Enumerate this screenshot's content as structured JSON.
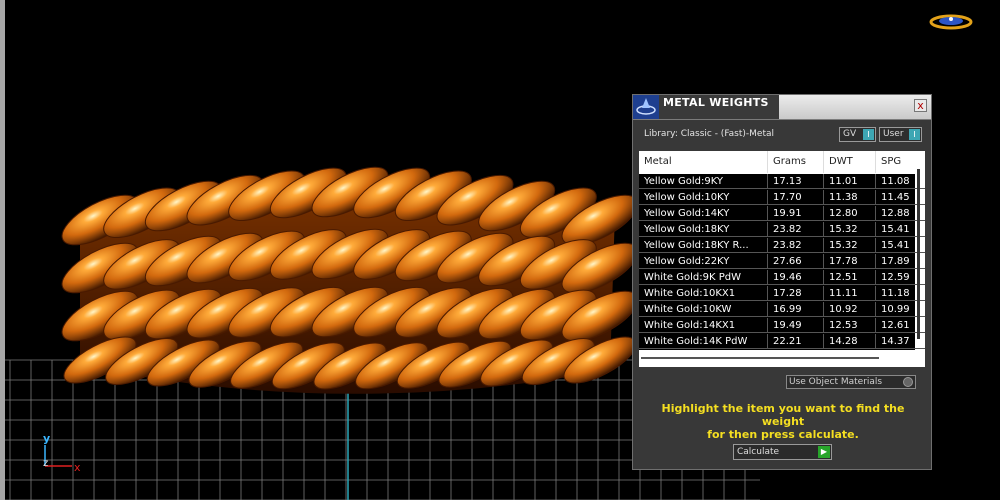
{
  "panel": {
    "title": "METAL WEIGHTS",
    "close_label": "x",
    "library_label": "Library: Classic - (Fast)-Metal",
    "toggle_gv": {
      "label": "GV",
      "value": "I"
    },
    "toggle_user": {
      "label": "User",
      "value": "I"
    },
    "table": {
      "columns": [
        "Metal",
        "Grams",
        "DWT",
        "SPG"
      ],
      "rows": [
        [
          "Yellow Gold:9KY",
          "17.13",
          "11.01",
          "11.08"
        ],
        [
          "Yellow Gold:10KY",
          "17.70",
          "11.38",
          "11.45"
        ],
        [
          "Yellow Gold:14KY",
          "19.91",
          "12.80",
          "12.88"
        ],
        [
          "Yellow Gold:18KY",
          "23.82",
          "15.32",
          "15.41"
        ],
        [
          "Yellow Gold:18KY R...",
          "23.82",
          "15.32",
          "15.41"
        ],
        [
          "Yellow Gold:22KY",
          "27.66",
          "17.78",
          "17.89"
        ],
        [
          "White Gold:9K PdW",
          "19.46",
          "12.51",
          "12.59"
        ],
        [
          "White Gold:10KX1",
          "17.28",
          "11.11",
          "11.18"
        ],
        [
          "White Gold:10KW",
          "16.99",
          "10.92",
          "10.99"
        ],
        [
          "White Gold:14KX1",
          "19.49",
          "12.53",
          "12.61"
        ],
        [
          "White Gold:14K PdW",
          "22.21",
          "14.28",
          "14.37"
        ]
      ]
    },
    "use_object_materials": "Use Object Materials",
    "help_line1": "Highlight the item you want to find the weight",
    "help_line2": "for then press calculate.",
    "calculate_label": "Calculate",
    "calculate_arrow": "▶"
  },
  "viewport": {
    "axis_y": "y",
    "axis_z": "z",
    "axis_x": "x",
    "ring_color": "#d2690e",
    "grid_color": "#7a7a7a",
    "accent_line_color": "#2aa7b8"
  },
  "icons": [
    "app-logo-icon",
    "panel-logo-icon",
    "close-icon",
    "calculate-arrow-icon"
  ]
}
